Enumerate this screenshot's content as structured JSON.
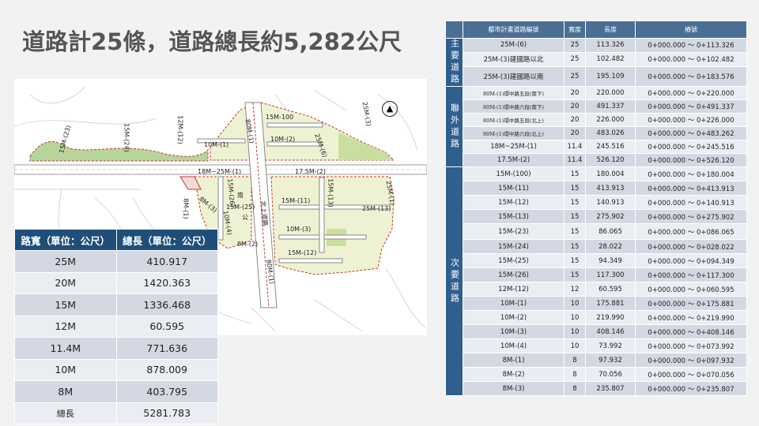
{
  "title": "道路計25條，道路總長約5,282公尺",
  "map": {
    "labels": {
      "r15m23": "15M-(23)",
      "r15m24": "15M-(24)",
      "r12m12": "12M-(12)",
      "r10m1": "10M-(1)",
      "r80m1a": "80M-(1)",
      "r15m100": "15M-100",
      "r10m2": "10M-(2)",
      "r25m6": "25M-(6)",
      "r25m3": "25M-(3)",
      "r18m": "18M~25M-(1)",
      "r175m2": "17.5M-(2)",
      "r25m1": "25M-(1)",
      "r8m1": "8M-(1)",
      "r8m3": "8M-(3)",
      "r15m26": "15M-(26)",
      "r15m25": "15M-(25)",
      "r10m4": "10M-(4)",
      "r8m2": "8M-(2)",
      "rdoc": "南",
      "rpark": "公",
      "r15m11": "15M-(11)",
      "r15m13": "15M-(13)",
      "r25m13": "25M-(13)",
      "r10m3": "10M-(3)",
      "r15m12": "15M-(12)",
      "r80m1b": "80M-(1)",
      "rnorth": "北上道路"
    }
  },
  "left_table": {
    "headers": [
      "路寬（單位：公尺）",
      "總長（單位：公尺）"
    ],
    "rows": [
      [
        "25M",
        "410.917"
      ],
      [
        "20M",
        "1420.363"
      ],
      [
        "15M",
        "1336.468"
      ],
      [
        "12M",
        "60.595"
      ],
      [
        "11.4M",
        "771.636"
      ],
      [
        "10M",
        "878.009"
      ],
      [
        "8M",
        "403.795"
      ],
      [
        "總長",
        "5281.783"
      ]
    ]
  },
  "right_table": {
    "headers": [
      "都市計畫道路編號",
      "寬度",
      "長度",
      "樁號"
    ],
    "categories": [
      {
        "label": "主要道路",
        "rows": [
          [
            "25M-(6)",
            "25",
            "113.326",
            "0+000.000 ～ 0+113.326"
          ],
          [
            "25M-(3)建國路以北",
            "25",
            "102.482",
            "0+000.000 ～ 0+102.482"
          ],
          [
            "25M-(3)建國路以南",
            "25",
            "195.109",
            "0+000.000 ～ 0+183.576"
          ]
        ]
      },
      {
        "label": "聯外道路",
        "rows": [
          [
            "80M-(1)環中路五段(南下)",
            "20",
            "220.000",
            "0+000.000 ～ 0+220.000"
          ],
          [
            "80M-(1)環中路六段(南下)",
            "20",
            "491.337",
            "0+000.000 ～ 0+491.337"
          ],
          [
            "80M-(1)環中路五段(北上)",
            "20",
            "226.000",
            "0+000.000 ～ 0+226.000"
          ],
          [
            "80M-(1)環中路六段(北上)",
            "20",
            "483.026",
            "0+000.000 ～ 0+483.262"
          ],
          [
            "18M~25M-(1)",
            "11.4",
            "245.516",
            "0+000.000 ～ 0+245.516"
          ],
          [
            "17.5M-(2)",
            "11.4",
            "526.120",
            "0+000.000 ～ 0+526.120"
          ]
        ]
      },
      {
        "label": "次要道路",
        "rows": [
          [
            "15M-(100)",
            "15",
            "180.004",
            "0+000.000 ～ 0+180.004"
          ],
          [
            "15M-(11)",
            "15",
            "413.913",
            "0+000.000 ～ 0+413.913"
          ],
          [
            "15M-(12)",
            "15",
            "140.913",
            "0+000.000 ～ 0+140.913"
          ],
          [
            "15M-(13)",
            "15",
            "275.902",
            "0+000.000 ～ 0+275.902"
          ],
          [
            "15M-(23)",
            "15",
            "86.065",
            "0+000.000 ～ 0+086.065"
          ],
          [
            "15M-(24)",
            "15",
            "28.022",
            "0+000.000 ～ 0+028.022"
          ],
          [
            "15M-(25)",
            "15",
            "94.349",
            "0+000.000 ～ 0+094.349"
          ],
          [
            "15M-(26)",
            "15",
            "117.300",
            "0+000.000 ～ 0+117.300"
          ],
          [
            "12M-(12)",
            "12",
            "60.595",
            "0+000.000 ～ 0+060.595"
          ],
          [
            "10M-(1)",
            "10",
            "175.881",
            "0+000.000 ～ 0+175.881"
          ],
          [
            "10M-(2)",
            "10",
            "219.990",
            "0+000.000 ～ 0+219.990"
          ],
          [
            "10M-(3)",
            "10",
            "408.146",
            "0+000.000 ～ 0+408.146"
          ],
          [
            "10M-(4)",
            "10",
            "73.992",
            "0+000.000 ～ 0+073.992"
          ],
          [
            "8M-(1)",
            "8",
            "97.932",
            "0+000.000 ～ 0+097.932"
          ],
          [
            "8M-(2)",
            "8",
            "70.056",
            "0+000.000 ～ 0+070.056"
          ],
          [
            "8M-(3)",
            "8",
            "235.807",
            "0+000.000 ～ 0+235.807"
          ]
        ]
      }
    ]
  }
}
